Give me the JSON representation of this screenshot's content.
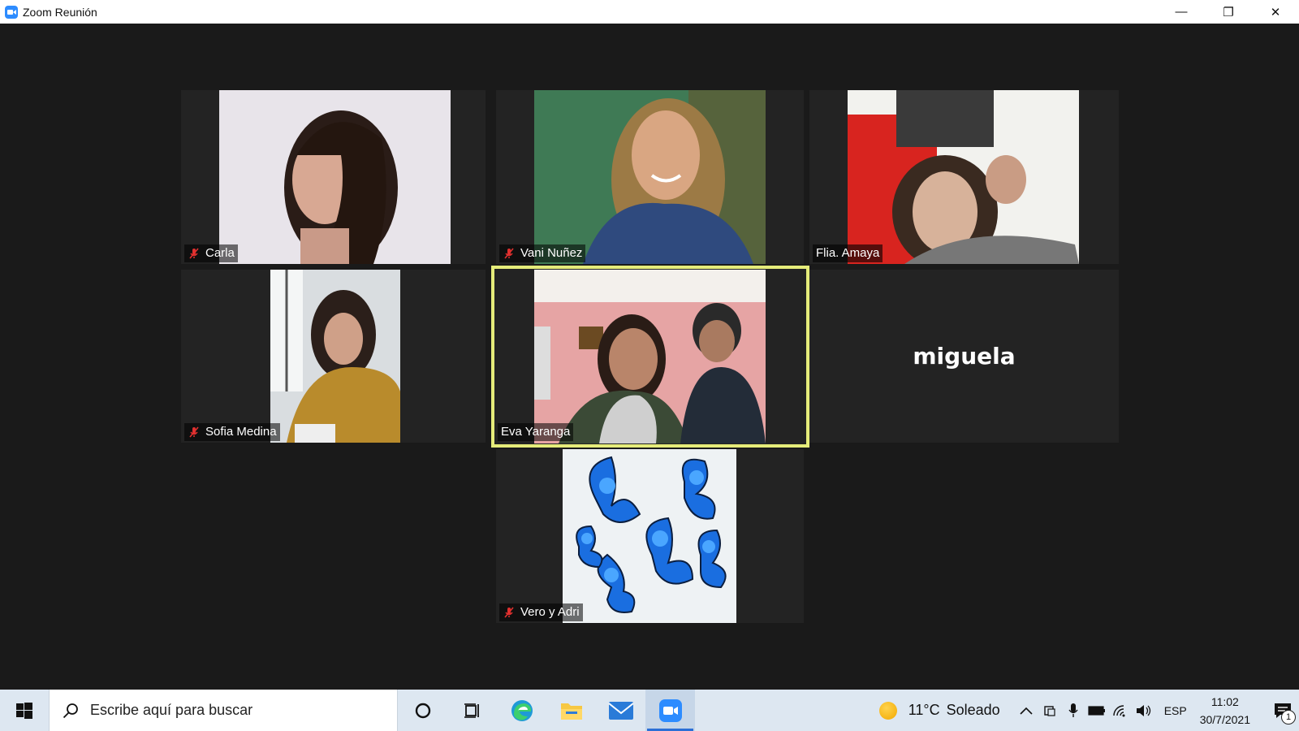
{
  "window": {
    "title": "Zoom Reunión",
    "minimize_glyph": "—",
    "restore_glyph": "❐",
    "close_glyph": "✕"
  },
  "participants": [
    {
      "name": "Carla",
      "muted": true,
      "video": "woman-curly-hair"
    },
    {
      "name": "Vani Nuñez",
      "muted": true,
      "video": "woman-smiling-blue-sweater"
    },
    {
      "name": "Flia. Amaya",
      "muted": false,
      "video": "woman-and-boy-red-wall"
    },
    {
      "name": "Sofia Medina",
      "muted": true,
      "video": "woman-yellow-sweater"
    },
    {
      "name": "Eva Yaranga",
      "muted": false,
      "speaking": true,
      "video": "woman-and-boy-pink-room"
    },
    {
      "name": "miguela",
      "video_off": true
    },
    {
      "name": "Vero y Adri",
      "muted": true,
      "video": "blue-butterflies"
    }
  ],
  "taskbar": {
    "search_placeholder": "Escribe aquí para buscar",
    "apps": [
      "cortana-circle-icon",
      "task-view-icon",
      "edge-icon",
      "file-explorer-icon",
      "mail-icon",
      "zoom-icon"
    ],
    "weather": {
      "temp": "11°C",
      "condition": "Soleado"
    },
    "language": "ESP",
    "time": "11:02",
    "date": "30/7/2021",
    "notification_count": "1"
  },
  "colors": {
    "speaker_outline": "#e5ec7a",
    "mute_red": "#e0302f",
    "zoom_blue": "#2d8cff"
  }
}
